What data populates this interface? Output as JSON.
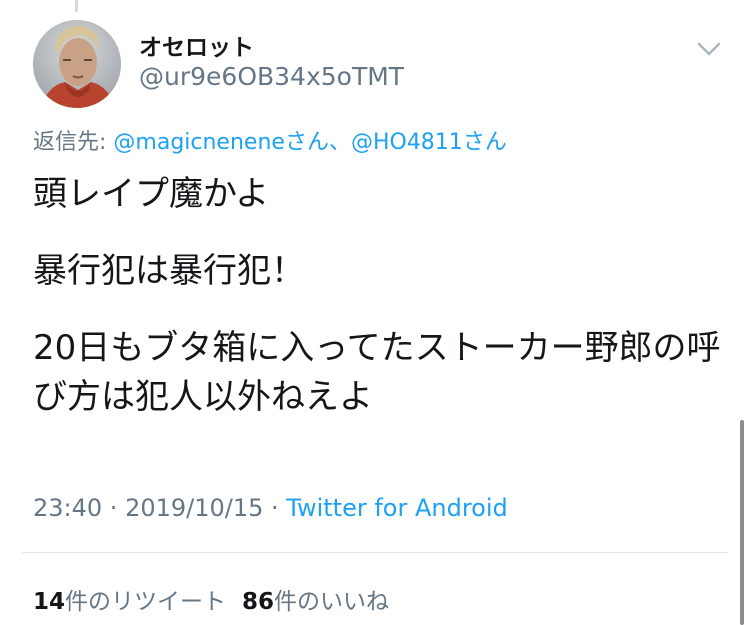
{
  "tweet": {
    "display_name": "オセロット",
    "handle": "@ur9e6OB34x5oTMT",
    "reply_to": {
      "prefix": "返信先: ",
      "mention1": "@magicnenene",
      "suffix1": "さん、",
      "mention2": "@HO4811",
      "suffix2": "さん"
    },
    "lines": [
      "頭レイプ魔かよ",
      "暴行犯は暴行犯！",
      "20日もブタ箱に入ってたストーカー野郎の呼び方は犯人以外ねえよ"
    ],
    "time": "23:40",
    "separator": " · ",
    "date": "2019/10/15",
    "source": "Twitter for Android"
  },
  "stats": {
    "retweets_count": "14",
    "retweets_label": "件のリツイート",
    "likes_count": "86",
    "likes_label": "件のいいね"
  },
  "icons": {
    "menu": "chevron-down-icon",
    "avatar": "profile-avatar"
  },
  "colors": {
    "link": "#1da1f2",
    "secondary": "#657786",
    "text": "#14171a"
  }
}
